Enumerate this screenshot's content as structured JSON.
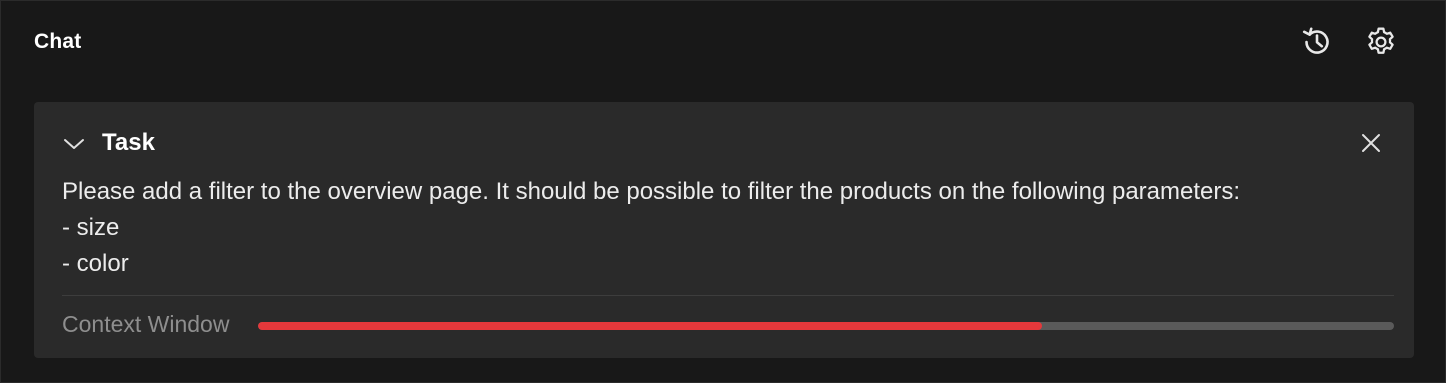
{
  "header": {
    "title": "Chat",
    "icons": [
      "history-icon",
      "gear-icon"
    ]
  },
  "task": {
    "title": "Task",
    "collapse_icon": "chevron-down-icon",
    "close_icon": "close-icon",
    "lines": [
      "Please add a filter to the overview page. It should be possible to filter the products on the following parameters:",
      "- size",
      "- color"
    ]
  },
  "context_window": {
    "label": "Context Window",
    "usage_fraction": 0.69,
    "fill_color": "#e5383b",
    "track_color": "#5a5a5a"
  }
}
